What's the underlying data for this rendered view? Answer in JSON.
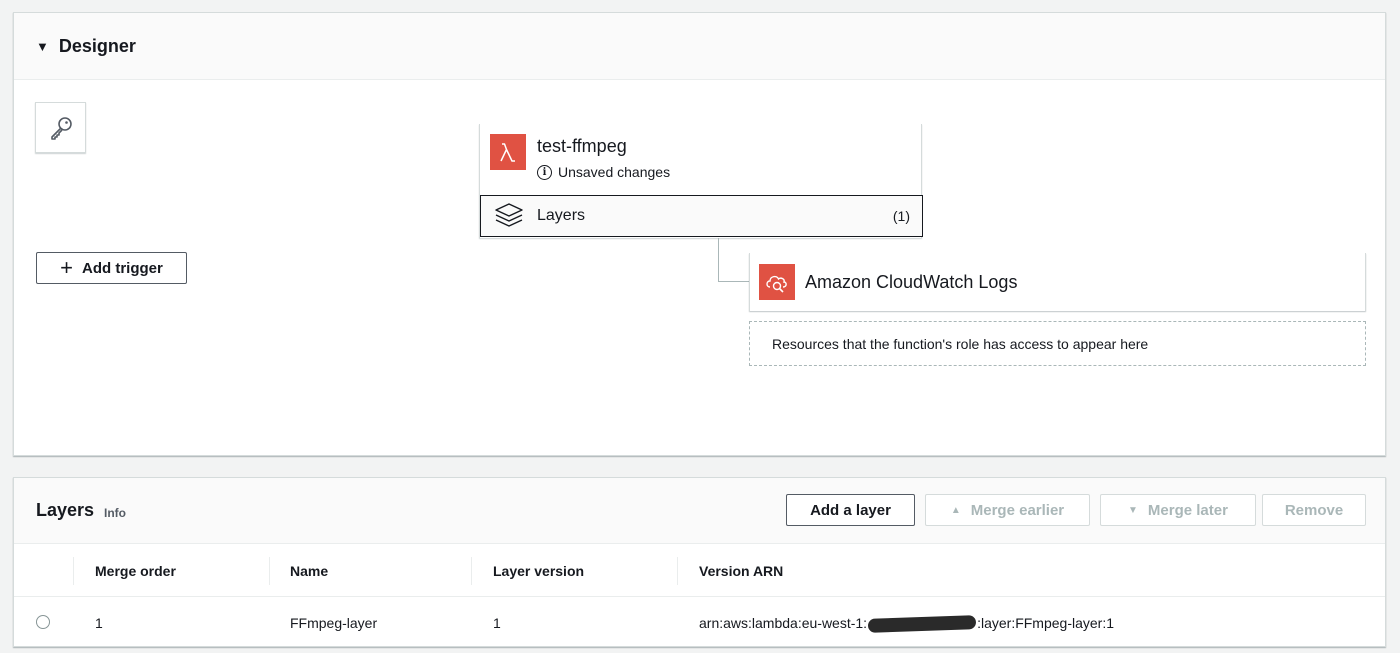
{
  "designer": {
    "title": "Designer",
    "add_trigger_label": "Add trigger",
    "function": {
      "name": "test-ffmpeg",
      "status": "Unsaved changes",
      "layers_label": "Layers",
      "layers_count": "(1)"
    },
    "destination": {
      "name": "Amazon CloudWatch Logs"
    },
    "resources_note": "Resources that the function's role has access to appear here"
  },
  "layers_panel": {
    "title": "Layers",
    "info_label": "Info",
    "buttons": {
      "add_layer": "Add a layer",
      "merge_earlier": "Merge earlier",
      "merge_later": "Merge later",
      "remove": "Remove"
    },
    "columns": [
      "Merge order",
      "Name",
      "Layer version",
      "Version ARN"
    ],
    "rows": [
      {
        "merge_order": "1",
        "name": "FFmpeg-layer",
        "version": "1",
        "arn_prefix": "arn:aws:lambda:eu-west-1:",
        "arn_suffix": ":layer:FFmpeg-layer:1"
      }
    ]
  },
  "colors": {
    "lambda_orange": "#e05243",
    "border": "#d5dbdb",
    "text": "#16191f"
  }
}
